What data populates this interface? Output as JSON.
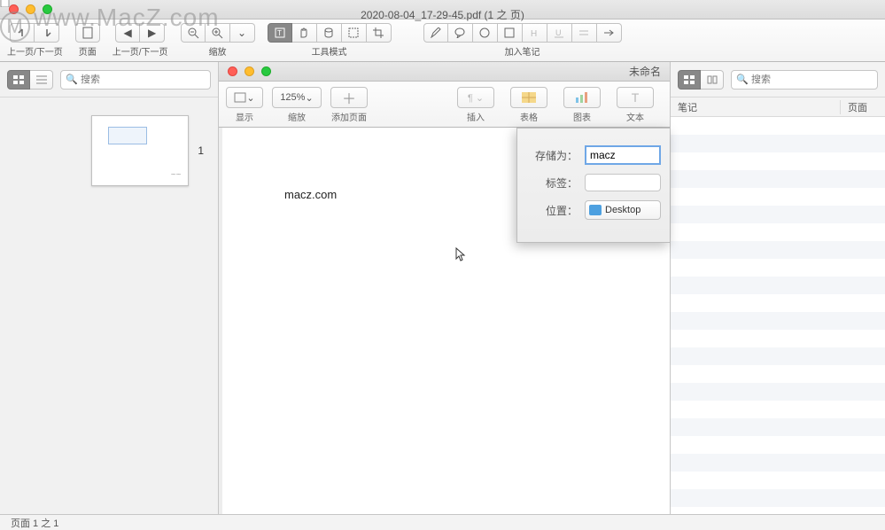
{
  "watermark": "www.MacZ.com",
  "title": {
    "file": "2020-08-04_17-29-45.pdf",
    "suffix": "(1 之 页)"
  },
  "toolbar": {
    "groups": {
      "prevnext": "上一页/下一页",
      "page": "页面",
      "prevnext2": "上一页/下一页",
      "zoom": "缩放",
      "toolmode": "工具模式",
      "addnote": "加入笔记"
    }
  },
  "left": {
    "search_placeholder": "搜索",
    "page_num": "1"
  },
  "sub": {
    "title_right": "未命名",
    "zoom_value": "125%",
    "groups": {
      "view": "显示",
      "zoom": "缩放",
      "addpage": "添加页面",
      "insert": "插入",
      "table": "表格",
      "chart": "图表",
      "text": "文本"
    }
  },
  "doc": {
    "body_text": "macz.com"
  },
  "sheet": {
    "save_as_label": "存储为：",
    "save_as_value": "macz",
    "tag_label": "标签：",
    "loc_label": "位置：",
    "loc_value": "Desktop"
  },
  "right": {
    "search_placeholder": "搜索",
    "col_notes": "笔记",
    "col_page": "页面"
  },
  "status": {
    "text": "页面 1 之 1"
  }
}
